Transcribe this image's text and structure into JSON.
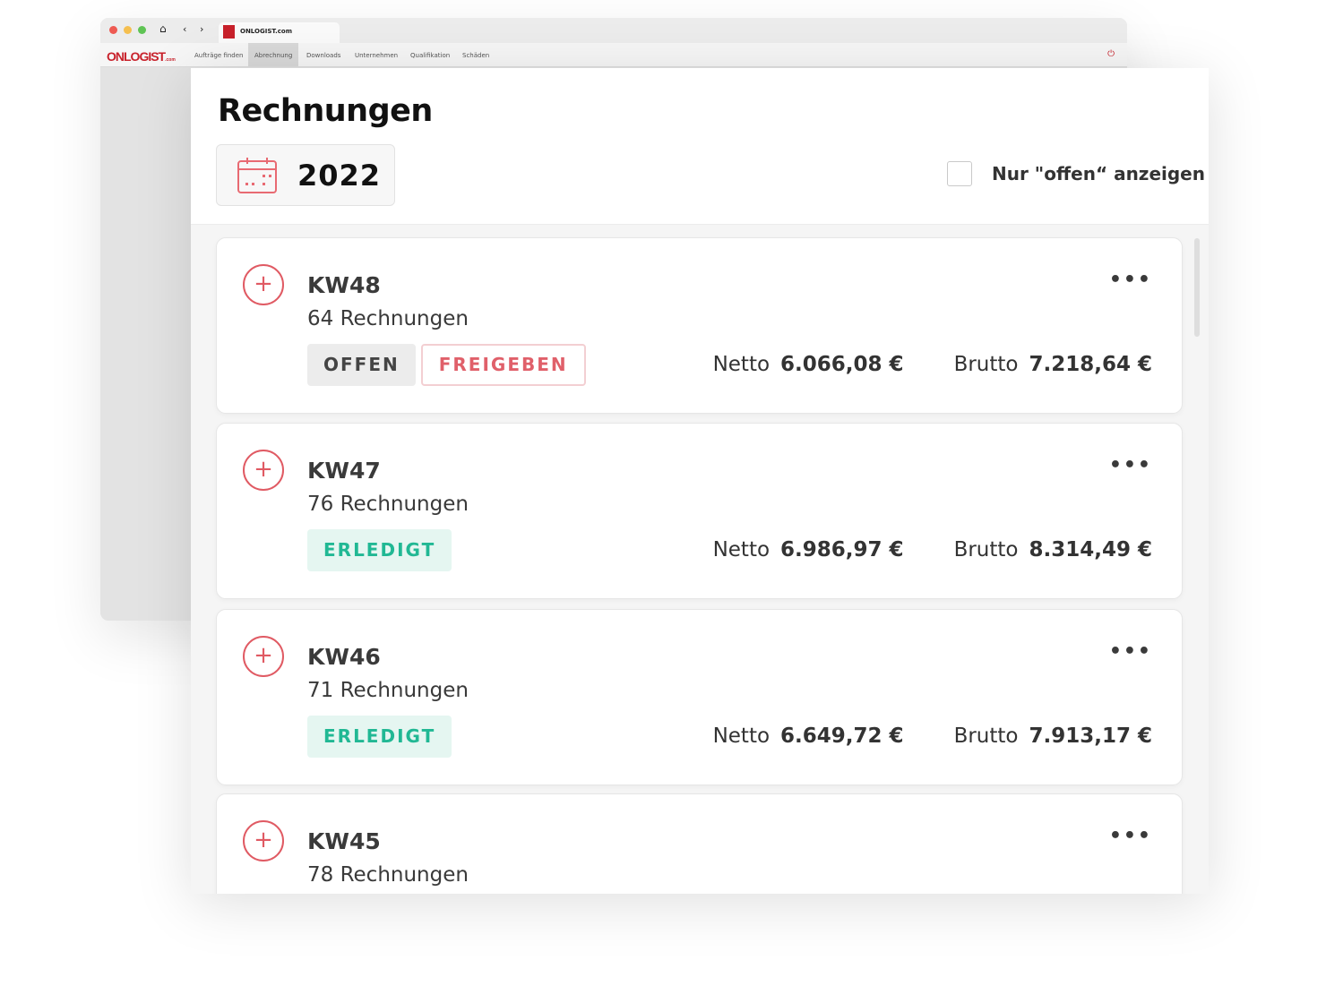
{
  "browser": {
    "tab_title": "ONLOGIST.com",
    "logo_text": "ONLOGIST",
    "logo_suffix": ".com",
    "nav": [
      "Aufträge finden",
      "Abrechnung",
      "Downloads",
      "Unternehmen",
      "Qualifikation",
      "Schäden"
    ],
    "active_nav": "Abrechnung"
  },
  "page": {
    "title": "Rechnungen",
    "year": "2022",
    "filter_label": "Nur \"offen“ anzeigen",
    "filter_checked": false
  },
  "weeks": [
    {
      "kw": "KW48",
      "count": "64 Rechnungen",
      "status": [
        "OFFEN",
        "FREIGEBEN"
      ],
      "netto_label": "Netto",
      "netto": "6.066,08 €",
      "brutto_label": "Brutto",
      "brutto": "7.218,64 €"
    },
    {
      "kw": "KW47",
      "count": "76 Rechnungen",
      "status": [
        "ERLEDIGT"
      ],
      "netto_label": "Netto",
      "netto": "6.986,97 €",
      "brutto_label": "Brutto",
      "brutto": "8.314,49 €"
    },
    {
      "kw": "KW46",
      "count": "71 Rechnungen",
      "status": [
        "ERLEDIGT"
      ],
      "netto_label": "Netto",
      "netto": "6.649,72 €",
      "brutto_label": "Brutto",
      "brutto": "7.913,17 €"
    },
    {
      "kw": "KW45",
      "count": "78 Rechnungen"
    }
  ],
  "colors": {
    "brand": "#c8212b",
    "accent_red": "#e05a63",
    "done_green": "#21b894"
  },
  "icons": {
    "expand": "plus-circle-icon",
    "menu": "more-horizontal-icon",
    "calendar": "calendar-icon"
  }
}
